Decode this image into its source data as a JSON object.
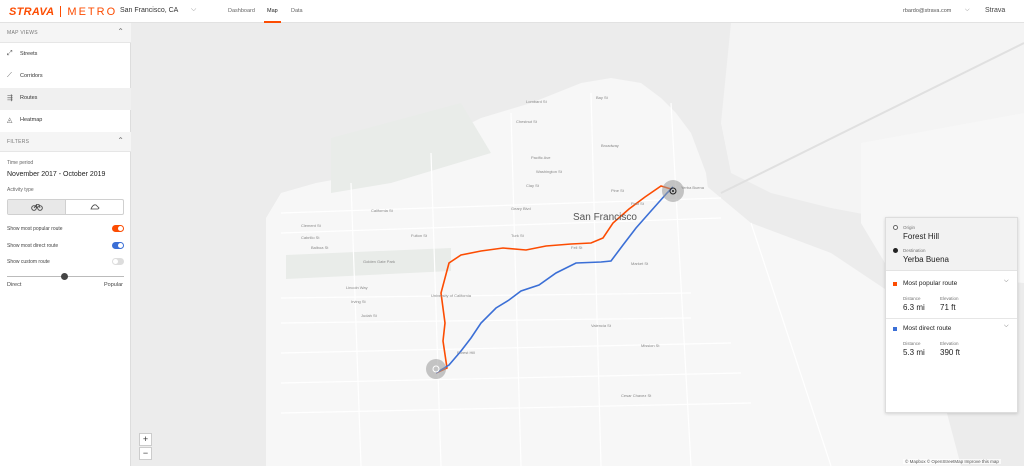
{
  "brand": {
    "name": "STRAVA",
    "product": "METRO"
  },
  "header": {
    "city": "San Francisco, CA",
    "tabs": [
      {
        "label": "Dashboard"
      },
      {
        "label": "Map"
      },
      {
        "label": "Data"
      }
    ],
    "user_email": "rbardo@strava.com",
    "user_org": "Strava",
    "accent": "#fc4c02"
  },
  "sidebar": {
    "map_views_title": "MAP VIEWS",
    "map_views": [
      {
        "label": "Streets",
        "icon": "streets-icon"
      },
      {
        "label": "Corridors",
        "icon": "corridors-icon"
      },
      {
        "label": "Routes",
        "icon": "routes-icon",
        "active": true
      },
      {
        "label": "Heatmap",
        "icon": "heatmap-icon"
      }
    ],
    "filters_title": "FILTERS",
    "time_period_label": "Time period",
    "time_period_value": "November 2017 - October 2019",
    "activity_type_label": "Activity type",
    "activity_types": [
      {
        "icon": "bike-icon",
        "selected": true
      },
      {
        "icon": "run-icon",
        "selected": false
      }
    ],
    "toggles": [
      {
        "label": "Show most popular route",
        "on": true,
        "color": "#fc4c02"
      },
      {
        "label": "Show most direct route",
        "on": true,
        "color": "#3b6fd6"
      },
      {
        "label": "Show custom route",
        "on": false,
        "color": "#cccccc"
      }
    ],
    "slider": {
      "left_label": "Direct",
      "right_label": "Popular",
      "value": 0.5
    }
  },
  "map": {
    "city_label": "San Francisco",
    "street_labels": [
      "Lombard St",
      "Bay St",
      "Chestnut St",
      "Broadway",
      "Pacific Ave",
      "Washington St",
      "Clay St",
      "Pine St",
      "California St",
      "Geary Blvd",
      "Post St",
      "Turk St",
      "Fulton St",
      "Golden Gate Park",
      "Lincoln Way",
      "Irving St",
      "Judah St",
      "Market St",
      "Valencia St",
      "Mission St",
      "Cesar Chavez St",
      "University of California",
      "Forest Hill",
      "Yerba Buena",
      "Clement St",
      "Balboa St",
      "Cabrillo St",
      "Fell St"
    ],
    "zoom_in": "+",
    "zoom_out": "−",
    "attribution": "© Mapbox © OpenStreetMap  Improve this map",
    "popular_color": "#fc4c02",
    "direct_color": "#3b6fd6"
  },
  "panel": {
    "origin_label": "Origin",
    "origin_value": "Forest Hill",
    "destination_label": "Destination",
    "destination_value": "Yerba Buena",
    "routes": [
      {
        "title": "Most popular route",
        "color": "#fc4c02",
        "distance_label": "Distance",
        "distance": "6.3 mi",
        "elevation_label": "Elevation",
        "elevation": "71 ft"
      },
      {
        "title": "Most direct route",
        "color": "#3b6fd6",
        "distance_label": "Distance",
        "distance": "5.3 mi",
        "elevation_label": "Elevation",
        "elevation": "390 ft"
      }
    ]
  }
}
